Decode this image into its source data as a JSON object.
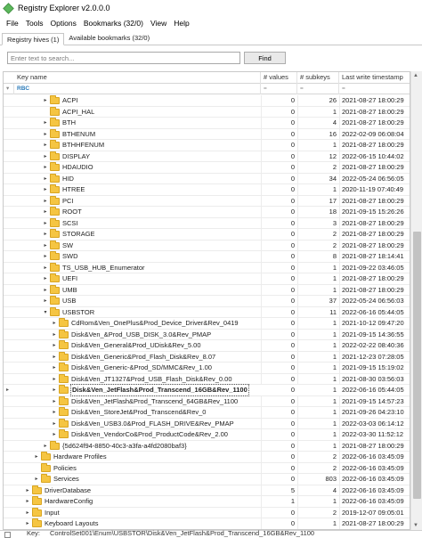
{
  "window": {
    "title": "Registry Explorer v2.0.0.0",
    "app_icon": "registry-explorer-logo-icon",
    "accent": "#5cb85c"
  },
  "menu": [
    {
      "label": "File"
    },
    {
      "label": "Tools"
    },
    {
      "label": "Options"
    },
    {
      "label": "Bookmarks (32/0)"
    },
    {
      "label": "View"
    },
    {
      "label": "Help"
    }
  ],
  "tabs": [
    {
      "label": "Registry hives (1)",
      "active": true
    },
    {
      "label": "Available bookmarks (32/0)",
      "active": false
    }
  ],
  "search": {
    "placeholder": "Enter text to search...",
    "value": "",
    "button_label": "Find"
  },
  "columns": {
    "key_name": "Key name",
    "values": "# values",
    "subkeys": "# subkeys",
    "timestamp": "Last write timestamp"
  },
  "filter_row": {
    "key_name": "RBC",
    "values": "=",
    "subkeys": "=",
    "timestamp": "="
  },
  "rows": [
    {
      "depth": 4,
      "expand": "▸",
      "name": "ACPI",
      "values": "0",
      "subkeys": "26",
      "timestamp": "2021-08-27 18:00:29"
    },
    {
      "depth": 4,
      "expand": "",
      "name": "ACPI_HAL",
      "values": "0",
      "subkeys": "1",
      "timestamp": "2021-08-27 18:00:29"
    },
    {
      "depth": 4,
      "expand": "▸",
      "name": "BTH",
      "values": "0",
      "subkeys": "4",
      "timestamp": "2021-08-27 18:00:29"
    },
    {
      "depth": 4,
      "expand": "▸",
      "name": "BTHENUM",
      "values": "0",
      "subkeys": "16",
      "timestamp": "2022-02-09 06:08:04"
    },
    {
      "depth": 4,
      "expand": "▸",
      "name": "BTHHFENUM",
      "values": "0",
      "subkeys": "1",
      "timestamp": "2021-08-27 18:00:29"
    },
    {
      "depth": 4,
      "expand": "▸",
      "name": "DISPLAY",
      "values": "0",
      "subkeys": "12",
      "timestamp": "2022-06-15 10:44:02"
    },
    {
      "depth": 4,
      "expand": "▸",
      "name": "HDAUDIO",
      "values": "0",
      "subkeys": "2",
      "timestamp": "2021-08-27 18:00:29"
    },
    {
      "depth": 4,
      "expand": "▸",
      "name": "HID",
      "values": "0",
      "subkeys": "34",
      "timestamp": "2022-05-24 06:56:05"
    },
    {
      "depth": 4,
      "expand": "▸",
      "name": "HTREE",
      "values": "0",
      "subkeys": "1",
      "timestamp": "2020-11-19 07:40:49"
    },
    {
      "depth": 4,
      "expand": "▸",
      "name": "PCI",
      "values": "0",
      "subkeys": "17",
      "timestamp": "2021-08-27 18:00:29"
    },
    {
      "depth": 4,
      "expand": "▸",
      "name": "ROOT",
      "values": "0",
      "subkeys": "18",
      "timestamp": "2021-09-15 15:26:26"
    },
    {
      "depth": 4,
      "expand": "▸",
      "name": "SCSI",
      "values": "0",
      "subkeys": "3",
      "timestamp": "2021-08-27 18:00:29"
    },
    {
      "depth": 4,
      "expand": "▸",
      "name": "STORAGE",
      "values": "0",
      "subkeys": "2",
      "timestamp": "2021-08-27 18:00:29"
    },
    {
      "depth": 4,
      "expand": "▸",
      "name": "SW",
      "values": "0",
      "subkeys": "2",
      "timestamp": "2021-08-27 18:00:29"
    },
    {
      "depth": 4,
      "expand": "▸",
      "name": "SWD",
      "values": "0",
      "subkeys": "8",
      "timestamp": "2021-08-27 18:14:41"
    },
    {
      "depth": 4,
      "expand": "▸",
      "name": "TS_USB_HUB_Enumerator",
      "values": "0",
      "subkeys": "1",
      "timestamp": "2021-09-22 03:46:05"
    },
    {
      "depth": 4,
      "expand": "▸",
      "name": "UEFI",
      "values": "0",
      "subkeys": "1",
      "timestamp": "2021-08-27 18:00:29"
    },
    {
      "depth": 4,
      "expand": "▸",
      "name": "UMB",
      "values": "0",
      "subkeys": "1",
      "timestamp": "2021-08-27 18:00:29"
    },
    {
      "depth": 4,
      "expand": "▸",
      "name": "USB",
      "values": "0",
      "subkeys": "37",
      "timestamp": "2022-05-24 06:56:03"
    },
    {
      "depth": 4,
      "expand": "▾",
      "name": "USBSTOR",
      "values": "0",
      "subkeys": "11",
      "timestamp": "2022-06-16 05:44:05"
    },
    {
      "depth": 5,
      "expand": "▸",
      "name": "CdRom&Ven_OnePlus&Prod_Device_Driver&Rev_0419",
      "values": "0",
      "subkeys": "1",
      "timestamp": "2021-10-12 09:47:20"
    },
    {
      "depth": 5,
      "expand": "▸",
      "name": "Disk&Ven_&Prod_USB_DISK_3.0&Rev_PMAP",
      "values": "0",
      "subkeys": "1",
      "timestamp": "2021-09-15 14:36:55"
    },
    {
      "depth": 5,
      "expand": "▸",
      "name": "Disk&Ven_General&Prod_UDisk&Rev_5.00",
      "values": "0",
      "subkeys": "1",
      "timestamp": "2022-02-22 08:40:36"
    },
    {
      "depth": 5,
      "expand": "▸",
      "name": "Disk&Ven_Generic&Prod_Flash_Disk&Rev_8.07",
      "values": "0",
      "subkeys": "1",
      "timestamp": "2021-12-23 07:28:05"
    },
    {
      "depth": 5,
      "expand": "▸",
      "name": "Disk&Ven_Generic-&Prod_SD/MMC&Rev_1.00",
      "values": "0",
      "subkeys": "1",
      "timestamp": "2021-09-15 15:19:02"
    },
    {
      "depth": 5,
      "expand": "▸",
      "name": "Disk&Ven_JT1327&Prod_USB_Flash_Disk&Rev_0.00",
      "values": "0",
      "subkeys": "1",
      "timestamp": "2021-08-30 03:56:03"
    },
    {
      "depth": 5,
      "expand": "▸",
      "name": "Disk&Ven_JetFlash&Prod_Transcend_16GB&Rev_1100",
      "values": "0",
      "subkeys": "1",
      "timestamp": "2022-06-16 05:44:05",
      "focused": true,
      "current": true
    },
    {
      "depth": 5,
      "expand": "▸",
      "name": "Disk&Ven_JetFlash&Prod_Transcend_64GB&Rev_1100",
      "values": "0",
      "subkeys": "1",
      "timestamp": "2021-09-15 14:57:23"
    },
    {
      "depth": 5,
      "expand": "▸",
      "name": "Disk&Ven_StoreJet&Prod_Transcend&Rev_0",
      "values": "0",
      "subkeys": "1",
      "timestamp": "2021-09-26 04:23:10"
    },
    {
      "depth": 5,
      "expand": "▸",
      "name": "Disk&Ven_USB3.0&Prod_FLASH_DRIVE&Rev_PMAP",
      "values": "0",
      "subkeys": "1",
      "timestamp": "2022-03-03 06:14:12"
    },
    {
      "depth": 5,
      "expand": "▸",
      "name": "Disk&Ven_VendorCo&Prod_ProductCode&Rev_2.00",
      "values": "0",
      "subkeys": "1",
      "timestamp": "2022-03-30 11:52:12"
    },
    {
      "depth": 4,
      "expand": "▸",
      "name": "{5d624f94-8850-40c3-a3fa-a4fd2080baf3}",
      "values": "0",
      "subkeys": "1",
      "timestamp": "2021-08-27 18:00:29"
    },
    {
      "depth": 3,
      "expand": "▸",
      "name": "Hardware Profiles",
      "values": "0",
      "subkeys": "2",
      "timestamp": "2022-06-16 03:45:09"
    },
    {
      "depth": 3,
      "expand": "",
      "name": "Policies",
      "values": "0",
      "subkeys": "2",
      "timestamp": "2022-06-16 03:45:09"
    },
    {
      "depth": 3,
      "expand": "▸",
      "name": "Services",
      "values": "0",
      "subkeys": "803",
      "timestamp": "2022-06-16 03:45:09"
    },
    {
      "depth": 2,
      "expand": "▸",
      "name": "DriverDatabase",
      "values": "5",
      "subkeys": "4",
      "timestamp": "2022-06-16 03:45:09"
    },
    {
      "depth": 2,
      "expand": "▸",
      "name": "HardwareConfig",
      "values": "1",
      "subkeys": "1",
      "timestamp": "2022-06-16 03:45:09"
    },
    {
      "depth": 2,
      "expand": "▸",
      "name": "Input",
      "values": "0",
      "subkeys": "2",
      "timestamp": "2019-12-07 09:05:01"
    },
    {
      "depth": 2,
      "expand": "▸",
      "name": "Keyboard Layouts",
      "values": "0",
      "subkeys": "1",
      "timestamp": "2021-08-27 18:00:29"
    }
  ],
  "statusbar": {
    "label": "Key:",
    "path": "ControlSet001\\Enum\\USBSTOR\\Disk&Ven_JetFlash&Prod_Transcend_16GB&Rev_1100"
  },
  "colors": {
    "folder": "#f5c542",
    "folder_border": "#d9a521",
    "grid_line": "#ececec"
  }
}
